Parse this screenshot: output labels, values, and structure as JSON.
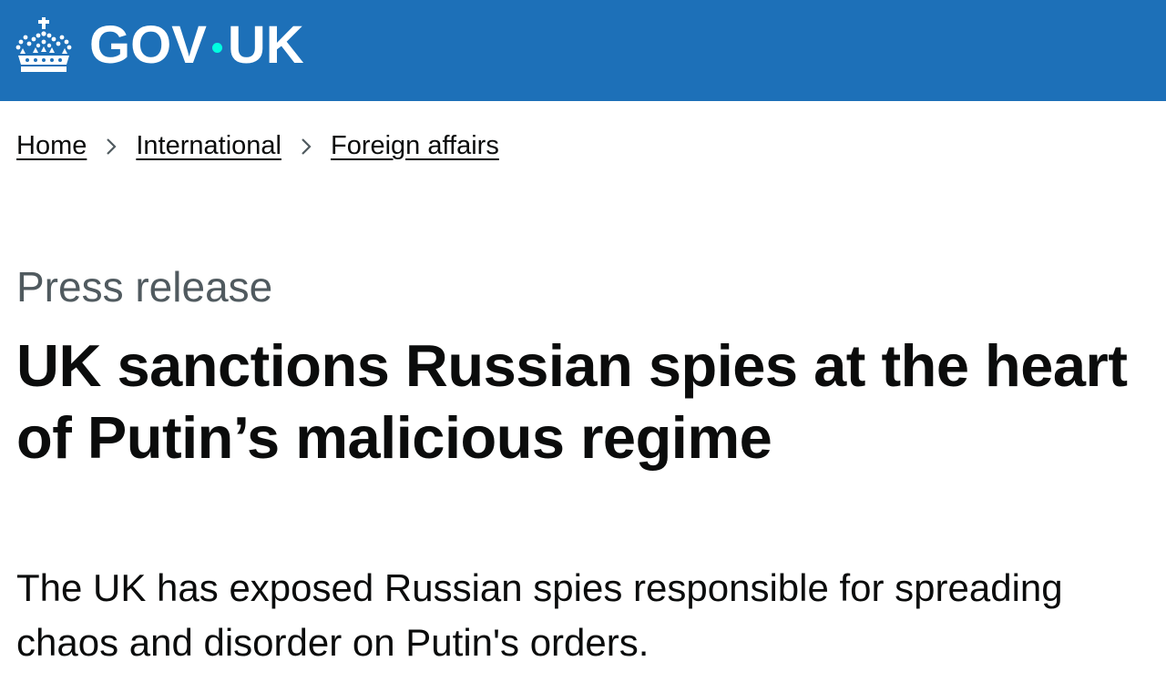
{
  "header": {
    "logo_text_left": "GOV",
    "logo_text_right": "UK",
    "brand_color": "#1d70b8",
    "dot_color": "#00ffe0",
    "logo_icon": "crown-icon"
  },
  "breadcrumbs": [
    {
      "label": "Home"
    },
    {
      "label": "International"
    },
    {
      "label": "Foreign affairs"
    }
  ],
  "breadcrumb_separator_icon": "chevron-right-icon",
  "article": {
    "caption": "Press release",
    "title": "UK sanctions Russian spies at the heart of Putin’s malicious regime",
    "lead": "The UK has exposed Russian spies responsible for spreading chaos and disorder on Putin's orders."
  }
}
